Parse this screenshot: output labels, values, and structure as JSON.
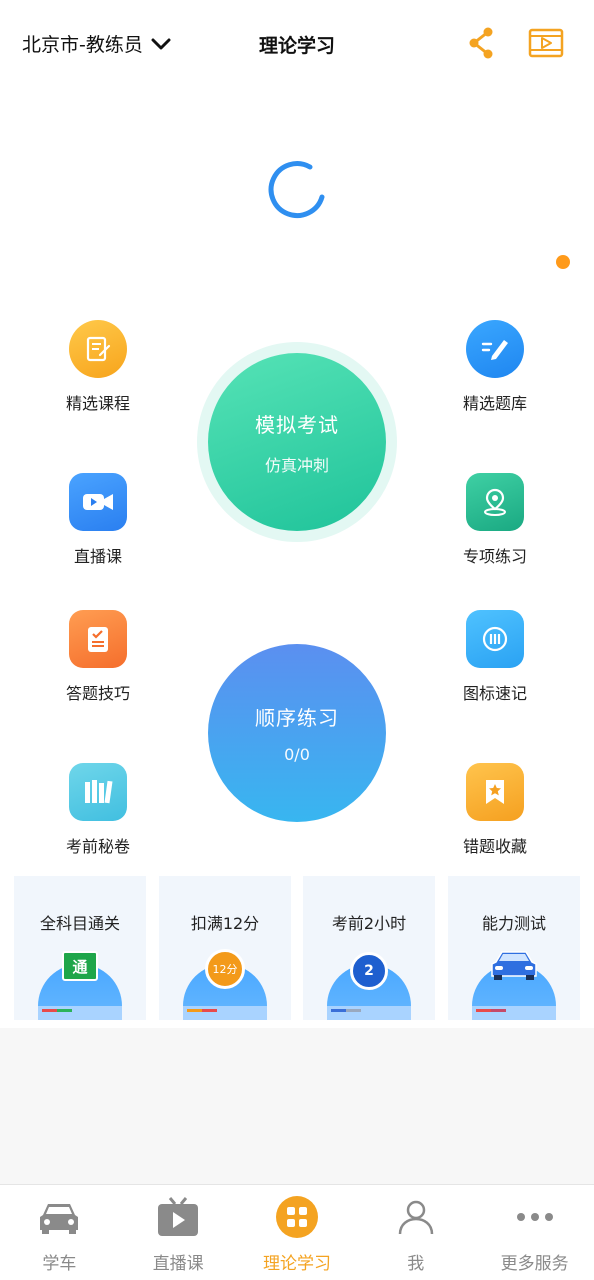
{
  "header": {
    "city": "北京市-教练员",
    "title": "理论学习"
  },
  "left_items": [
    {
      "label": "精选课程",
      "icon": "notebook-icon"
    },
    {
      "label": "直播课",
      "icon": "camera-icon"
    },
    {
      "label": "答题技巧",
      "icon": "clipboard-icon"
    },
    {
      "label": "考前秘卷",
      "icon": "books-icon"
    }
  ],
  "right_items": [
    {
      "label": "精选题库",
      "icon": "pencil-icon"
    },
    {
      "label": "专项练习",
      "icon": "location-pin-icon"
    },
    {
      "label": "图标速记",
      "icon": "sign-icon"
    },
    {
      "label": "错题收藏",
      "icon": "bookmark-star-icon"
    }
  ],
  "mock_exam": {
    "title": "模拟考试",
    "subtitle": "仿真冲刺"
  },
  "sequence_practice": {
    "title": "顺序练习",
    "progress": "0/0"
  },
  "cards": [
    {
      "label": "全科目通关",
      "badge": "通"
    },
    {
      "label": "扣满12分",
      "badge": "12分"
    },
    {
      "label": "考前2小时",
      "badge": "2"
    },
    {
      "label": "能力测试",
      "badge": ""
    }
  ],
  "tabs": [
    {
      "label": "学车",
      "icon": "car-icon"
    },
    {
      "label": "直播课",
      "icon": "tv-play-icon"
    },
    {
      "label": "理论学习",
      "icon": "grid-icon",
      "active": true
    },
    {
      "label": "我",
      "icon": "person-icon"
    },
    {
      "label": "更多服务",
      "icon": "more-dots-icon"
    }
  ],
  "colors": {
    "accent": "#f4a321",
    "spinner": "#2f8ff0",
    "mock_green": "#2ccaa0",
    "sequence_blue": "#4a9ef2",
    "card_bg": "#f1f6fc"
  }
}
